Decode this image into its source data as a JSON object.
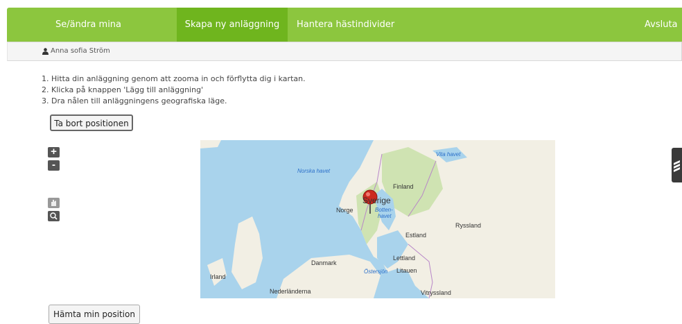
{
  "nav": {
    "items": [
      "Se/ändra mina anläggningar",
      "Skapa ny anläggning",
      "Hantera hästindivider"
    ],
    "logout": "Avsluta [",
    "active_index": 1
  },
  "user": {
    "name": "Anna sofia Ström",
    "icon": "user-icon"
  },
  "instructions": [
    "1. Hitta din anläggning genom att zooma in och förflytta dig i kartan.",
    "2. Klicka på knappen 'Lägg till anläggning'",
    "3. Dra nålen till anläggningens geografiska läge."
  ],
  "buttons": {
    "remove_position": "Ta bort positionen",
    "get_position": "Hämta min position"
  },
  "map": {
    "zoom_in": "+",
    "zoom_out": "-",
    "labels": {
      "norska_havet": "Norska havet",
      "vita_havet": "Vita havet",
      "finland": "Finland",
      "sverige": "Sverige",
      "norge": "Norge",
      "bottenhavet_1": "Botten-",
      "bottenhavet_2": "havet",
      "ryssland": "Ryssland",
      "estland": "Estland",
      "lettland": "Lettland",
      "danmark": "Danmark",
      "ostersjon": "Östersjön",
      "litauen": "Litauen",
      "irland": "Irland",
      "nederlanderna": "Nederländerna",
      "vitryssland": "Vitryssland"
    },
    "colors": {
      "sea": "#a9d3ec",
      "land": "#f2efe4",
      "forest": "#cfe3b2",
      "marker": "#cc2a1f"
    }
  },
  "colors": {
    "navbar": "#8cc63e",
    "navbar_active": "#6fb51e"
  }
}
